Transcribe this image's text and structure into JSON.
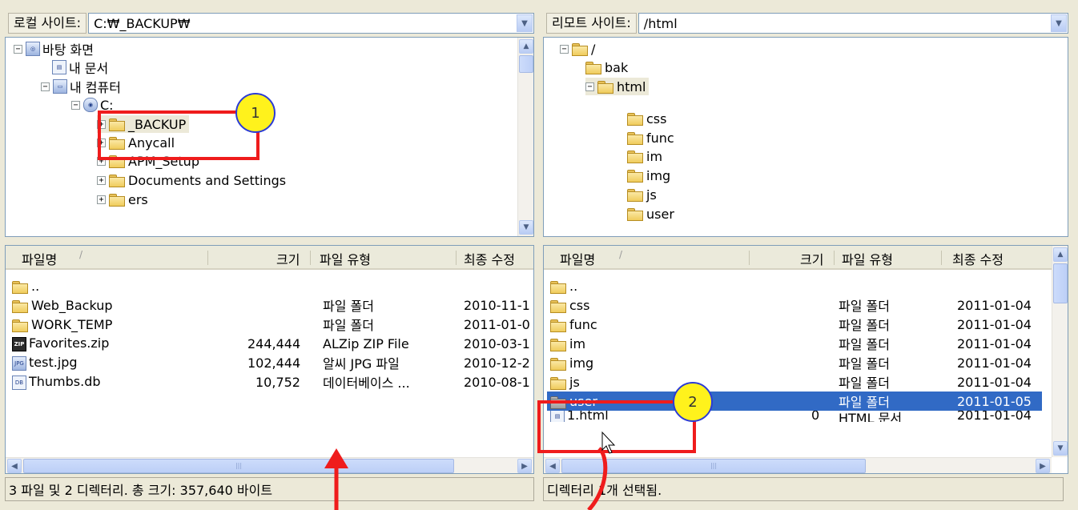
{
  "local": {
    "label": "로컬 사이트:",
    "path": "C:₩_BACKUP₩",
    "tree": [
      {
        "name": "바탕 화면",
        "expander": "⊟"
      },
      {
        "name": "내 문서",
        "expander": ""
      },
      {
        "name": "내 컴퓨터",
        "expander": "⊟"
      },
      {
        "name": "C:",
        "expander": "⊟"
      },
      {
        "name": "_BACKUP",
        "expander": "⊞"
      },
      {
        "name": "Anycall",
        "expander": "⊞"
      },
      {
        "name": "APM_Setup",
        "expander": "⊞"
      },
      {
        "name": "Documents and Settings",
        "expander": "⊞"
      },
      {
        "name": "ers",
        "expander": "⊞"
      }
    ],
    "columns": {
      "name": "파일명",
      "size": "크기",
      "type": "파일 유형",
      "modified": "최종 수정"
    },
    "files": [
      {
        "name": "..",
        "size": "",
        "type": "",
        "modified": ""
      },
      {
        "name": "Web_Backup",
        "size": "",
        "type": "파일 폴더",
        "modified": "2010-11-1"
      },
      {
        "name": "WORK_TEMP",
        "size": "",
        "type": "파일 폴더",
        "modified": "2011-01-0"
      },
      {
        "name": "Favorites.zip",
        "size": "244,444",
        "type": "ALZip ZIP File",
        "modified": "2010-03-1"
      },
      {
        "name": "test.jpg",
        "size": "102,444",
        "type": "알씨 JPG 파일",
        "modified": "2010-12-2"
      },
      {
        "name": "Thumbs.db",
        "size": "10,752",
        "type": "데이터베이스 ...",
        "modified": "2010-08-1"
      }
    ],
    "status": "3 파일 및 2 디렉터리. 총 크기: 357,640 바이트"
  },
  "remote": {
    "label": "리모트 사이트:",
    "path": "/html",
    "tree": [
      {
        "name": "/",
        "expander": "⊟"
      },
      {
        "name": "bak",
        "expander": ""
      },
      {
        "name": "html",
        "expander": "⊟"
      },
      {
        "name": "css",
        "expander": ""
      },
      {
        "name": "func",
        "expander": ""
      },
      {
        "name": "im",
        "expander": ""
      },
      {
        "name": "img",
        "expander": ""
      },
      {
        "name": "js",
        "expander": ""
      },
      {
        "name": "user",
        "expander": ""
      }
    ],
    "columns": {
      "name": "파일명",
      "size": "크기",
      "type": "파일 유형",
      "modified": "최종 수정"
    },
    "files": [
      {
        "name": "..",
        "size": "",
        "type": "",
        "modified": ""
      },
      {
        "name": "css",
        "size": "",
        "type": "파일 폴더",
        "modified": "2011-01-04"
      },
      {
        "name": "func",
        "size": "",
        "type": "파일 폴더",
        "modified": "2011-01-04"
      },
      {
        "name": "im",
        "size": "",
        "type": "파일 폴더",
        "modified": "2011-01-04"
      },
      {
        "name": "img",
        "size": "",
        "type": "파일 폴더",
        "modified": "2011-01-04"
      },
      {
        "name": "js",
        "size": "",
        "type": "파일 폴더",
        "modified": "2011-01-04"
      },
      {
        "name": "user",
        "size": "",
        "type": "파일 폴더",
        "modified": "2011-01-05",
        "selected": true
      },
      {
        "name": "1.html",
        "size": "0",
        "type": "HTML 문서",
        "modified": "2011-01-04"
      }
    ],
    "status": "디렉터리 1개 선택됨."
  },
  "annotations": {
    "badge1": "1",
    "badge2": "2"
  },
  "colors": {
    "accent_red": "#ef1c1c",
    "badge_fill": "#fff21c",
    "selection": "#316ac5"
  }
}
